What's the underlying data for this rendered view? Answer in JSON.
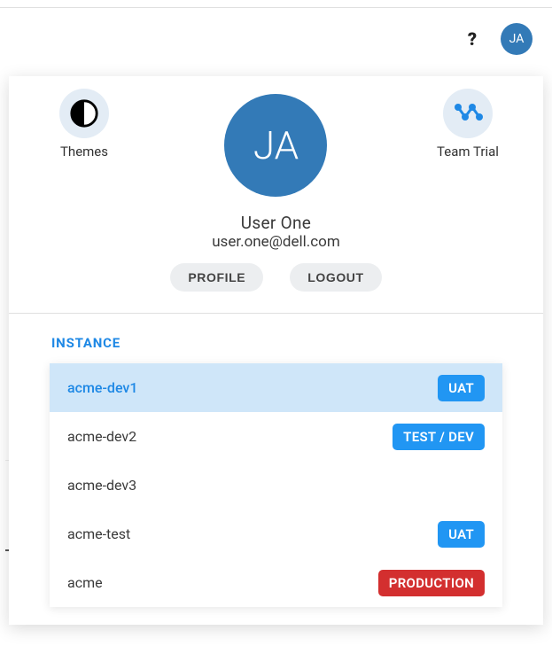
{
  "header": {
    "help_symbol": "?",
    "avatar_initials": "JA"
  },
  "popover": {
    "themes_label": "Themes",
    "team_trial_label": "Team Trial",
    "avatar_initials": "JA",
    "user_name": "User One",
    "user_email": "user.one@dell.com",
    "profile_label": "PROFILE",
    "logout_label": "LOGOUT",
    "instance_section_label": "INSTANCE"
  },
  "colors": {
    "brand_blue": "#337ab7",
    "accent_blue": "#1e88e5",
    "badge_blue": "#2196f3",
    "badge_red": "#d32f2f"
  },
  "instances": [
    {
      "name": "acme-dev1",
      "env": "UAT",
      "env_color": "#2196f3",
      "selected": true
    },
    {
      "name": "acme-dev2",
      "env": "TEST / DEV",
      "env_color": "#2196f3",
      "selected": false
    },
    {
      "name": "acme-dev3",
      "env": "",
      "env_color": "",
      "selected": false
    },
    {
      "name": "acme-test",
      "env": "UAT",
      "env_color": "#2196f3",
      "selected": false
    },
    {
      "name": "acme",
      "env": "PRODUCTION",
      "env_color": "#d32f2f",
      "selected": false
    }
  ]
}
